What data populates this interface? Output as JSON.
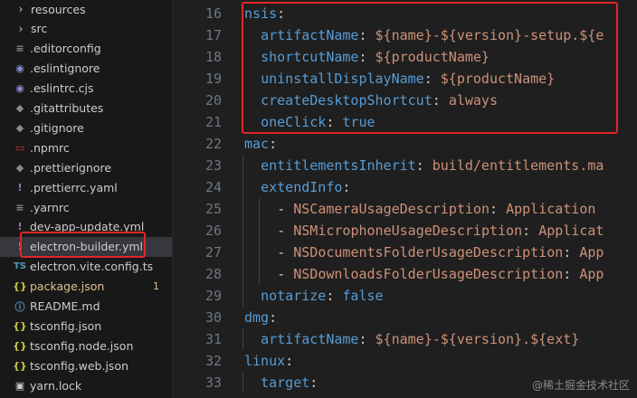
{
  "explorer": {
    "items": [
      {
        "name": "resources",
        "icon": "chevron-right-icon",
        "glyph": "›",
        "color": "#cccccc",
        "kind": "folder"
      },
      {
        "name": "src",
        "icon": "chevron-right-icon",
        "glyph": "›",
        "color": "#cccccc",
        "kind": "folder"
      },
      {
        "name": ".editorconfig",
        "icon": "settings-file-icon",
        "glyph": "≡",
        "color": "#8a8a8a"
      },
      {
        "name": ".eslintignore",
        "icon": "eslint-icon",
        "glyph": "◉",
        "color": "#8b8fd6"
      },
      {
        "name": ".eslintrc.cjs",
        "icon": "eslint-icon",
        "glyph": "◉",
        "color": "#8b8fd6"
      },
      {
        "name": ".gitattributes",
        "icon": "git-icon",
        "glyph": "◆",
        "color": "#8a8a8a"
      },
      {
        "name": ".gitignore",
        "icon": "git-icon",
        "glyph": "◆",
        "color": "#8a8a8a"
      },
      {
        "name": ".npmrc",
        "icon": "npm-icon",
        "glyph": "▭",
        "color": "#cb3837"
      },
      {
        "name": ".prettierignore",
        "icon": "prettier-icon",
        "glyph": "◆",
        "color": "#8a8a8a"
      },
      {
        "name": ".prettierrc.yaml",
        "icon": "yaml-exclaim-icon",
        "glyph": "!",
        "color": "#a074c4"
      },
      {
        "name": ".yarnrc",
        "icon": "settings-file-icon",
        "glyph": "≡",
        "color": "#8a8a8a"
      },
      {
        "name": "dev-app-update.yml",
        "icon": "yaml-exclaim-icon",
        "glyph": "!",
        "color": "#a074c4"
      },
      {
        "name": "electron-builder.yml",
        "icon": "yaml-exclaim-icon",
        "glyph": "!",
        "color": "#a074c4",
        "selected": true
      },
      {
        "name": "electron.vite.config.ts",
        "icon": "typescript-icon",
        "glyph": "TS",
        "color": "#519aba"
      },
      {
        "name": "package.json",
        "icon": "json-braces-icon",
        "glyph": "{}",
        "color": "#cbcb41",
        "modified": true,
        "badge": "1"
      },
      {
        "name": "README.md",
        "icon": "info-icon",
        "glyph": "ⓘ",
        "color": "#519aba"
      },
      {
        "name": "tsconfig.json",
        "icon": "json-braces-icon",
        "glyph": "{}",
        "color": "#cbcb41"
      },
      {
        "name": "tsconfig.node.json",
        "icon": "json-braces-icon",
        "glyph": "{}",
        "color": "#cbcb41"
      },
      {
        "name": "tsconfig.web.json",
        "icon": "json-braces-icon",
        "glyph": "{}",
        "color": "#cbcb41"
      },
      {
        "name": "yarn.lock",
        "icon": "lock-icon",
        "glyph": "▣",
        "color": "#cccccc"
      }
    ]
  },
  "editor": {
    "lines": [
      {
        "n": "16",
        "indent": 0,
        "tokens": [
          {
            "t": "nsis",
            "c": "k"
          },
          {
            "t": ":",
            "c": "p"
          }
        ]
      },
      {
        "n": "17",
        "indent": 1,
        "tokens": [
          {
            "t": "artifactName",
            "c": "k"
          },
          {
            "t": ": ",
            "c": "p"
          },
          {
            "t": "${name}-${version}-setup.${e",
            "c": "v"
          }
        ]
      },
      {
        "n": "18",
        "indent": 1,
        "tokens": [
          {
            "t": "shortcutName",
            "c": "k"
          },
          {
            "t": ": ",
            "c": "p"
          },
          {
            "t": "${productName}",
            "c": "v"
          }
        ]
      },
      {
        "n": "19",
        "indent": 1,
        "tokens": [
          {
            "t": "uninstallDisplayName",
            "c": "k"
          },
          {
            "t": ": ",
            "c": "p"
          },
          {
            "t": "${productName}",
            "c": "v"
          }
        ]
      },
      {
        "n": "20",
        "indent": 1,
        "tokens": [
          {
            "t": "createDesktopShortcut",
            "c": "k"
          },
          {
            "t": ": ",
            "c": "p"
          },
          {
            "t": "always",
            "c": "v"
          }
        ]
      },
      {
        "n": "21",
        "indent": 1,
        "tokens": [
          {
            "t": "oneClick",
            "c": "k"
          },
          {
            "t": ": ",
            "c": "p"
          },
          {
            "t": "true",
            "c": "k"
          }
        ]
      },
      {
        "n": "22",
        "indent": 0,
        "tokens": [
          {
            "t": "mac",
            "c": "k"
          },
          {
            "t": ":",
            "c": "p"
          }
        ]
      },
      {
        "n": "23",
        "indent": 1,
        "tokens": [
          {
            "t": "entitlementsInherit",
            "c": "k"
          },
          {
            "t": ": ",
            "c": "p"
          },
          {
            "t": "build/entitlements.ma",
            "c": "v"
          }
        ]
      },
      {
        "n": "24",
        "indent": 1,
        "tokens": [
          {
            "t": "extendInfo",
            "c": "k"
          },
          {
            "t": ":",
            "c": "p"
          }
        ]
      },
      {
        "n": "25",
        "indent": 2,
        "tokens": [
          {
            "t": "- ",
            "c": "p"
          },
          {
            "t": "NSCameraUsageDescription",
            "c": "v"
          },
          {
            "t": ": ",
            "c": "p"
          },
          {
            "t": "Application",
            "c": "v"
          }
        ]
      },
      {
        "n": "26",
        "indent": 2,
        "tokens": [
          {
            "t": "- ",
            "c": "p"
          },
          {
            "t": "NSMicrophoneUsageDescription",
            "c": "v"
          },
          {
            "t": ": ",
            "c": "p"
          },
          {
            "t": "Applicat",
            "c": "v"
          }
        ]
      },
      {
        "n": "27",
        "indent": 2,
        "tokens": [
          {
            "t": "- ",
            "c": "p"
          },
          {
            "t": "NSDocumentsFolderUsageDescription",
            "c": "v"
          },
          {
            "t": ": ",
            "c": "p"
          },
          {
            "t": "App",
            "c": "v"
          }
        ]
      },
      {
        "n": "28",
        "indent": 2,
        "tokens": [
          {
            "t": "- ",
            "c": "p"
          },
          {
            "t": "NSDownloadsFolderUsageDescription",
            "c": "v"
          },
          {
            "t": ": ",
            "c": "p"
          },
          {
            "t": "App",
            "c": "v"
          }
        ]
      },
      {
        "n": "29",
        "indent": 1,
        "tokens": [
          {
            "t": "notarize",
            "c": "k"
          },
          {
            "t": ": ",
            "c": "p"
          },
          {
            "t": "false",
            "c": "k"
          }
        ]
      },
      {
        "n": "30",
        "indent": 0,
        "tokens": [
          {
            "t": "dmg",
            "c": "k"
          },
          {
            "t": ":",
            "c": "p"
          }
        ]
      },
      {
        "n": "31",
        "indent": 1,
        "tokens": [
          {
            "t": "artifactName",
            "c": "k"
          },
          {
            "t": ": ",
            "c": "p"
          },
          {
            "t": "${name}-${version}.${ext}",
            "c": "v"
          }
        ]
      },
      {
        "n": "32",
        "indent": 0,
        "tokens": [
          {
            "t": "linux",
            "c": "k"
          },
          {
            "t": ":",
            "c": "p"
          }
        ]
      },
      {
        "n": "33",
        "indent": 1,
        "tokens": [
          {
            "t": "target",
            "c": "k"
          },
          {
            "t": ":",
            "c": "p"
          }
        ]
      }
    ]
  },
  "watermark": "@稀土掘金技术社区",
  "colors": {
    "highlight": "#e0272a",
    "key": "#569cd6",
    "string": "#ce9178"
  }
}
